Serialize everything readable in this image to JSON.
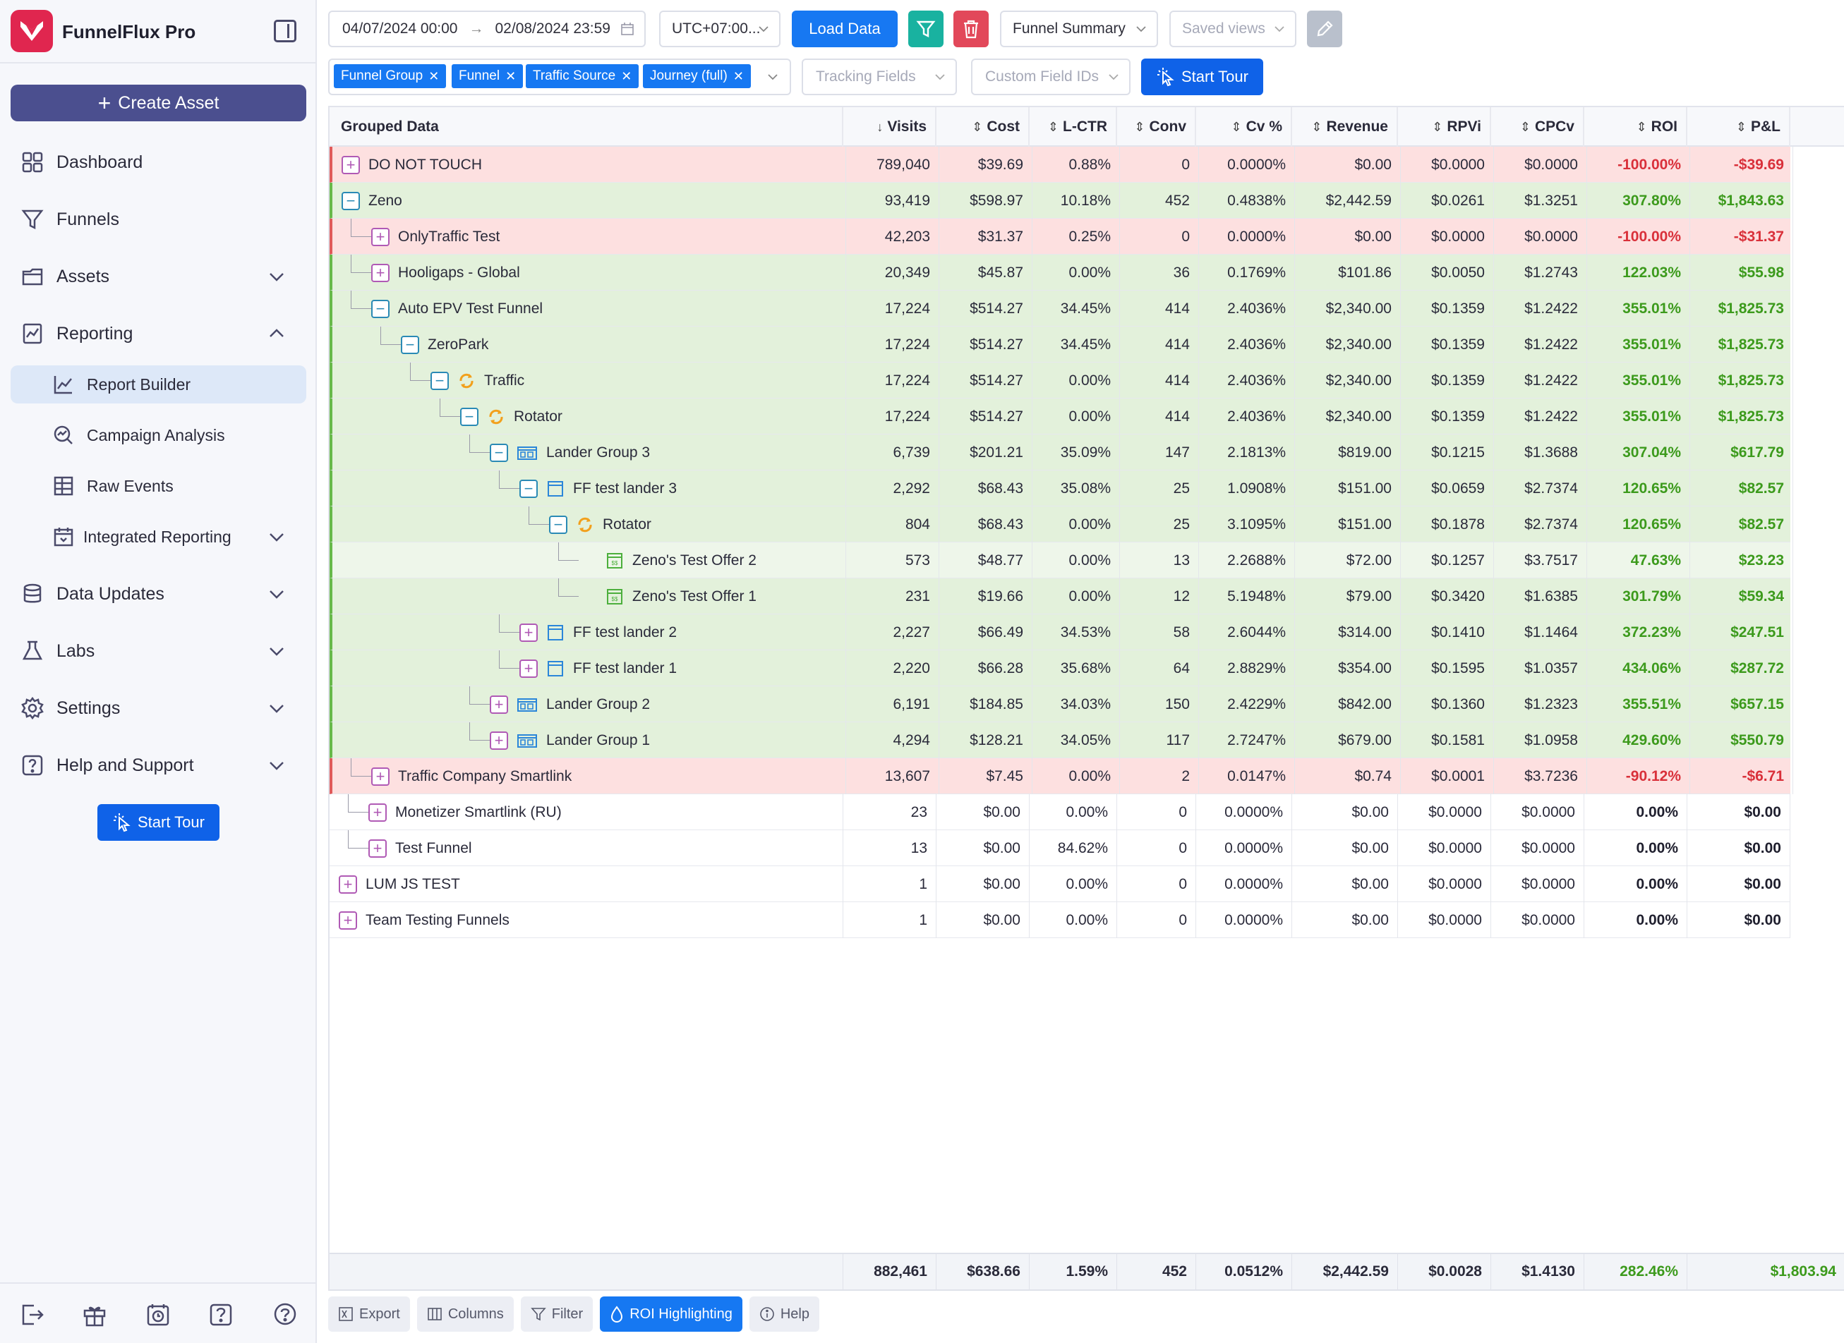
{
  "app": {
    "title": "FunnelFlux Pro"
  },
  "sidebar": {
    "create_label": "Create Asset",
    "items": [
      {
        "label": "Dashboard",
        "icon": "dashboard-icon"
      },
      {
        "label": "Funnels",
        "icon": "funnel-icon"
      },
      {
        "label": "Assets",
        "icon": "folder-icon"
      },
      {
        "label": "Reporting",
        "icon": "report-icon"
      },
      {
        "label": "Data Updates",
        "icon": "database-icon"
      },
      {
        "label": "Labs",
        "icon": "flask-icon"
      },
      {
        "label": "Settings",
        "icon": "gear-icon"
      },
      {
        "label": "Help and Support",
        "icon": "help-icon"
      }
    ],
    "sub_items": [
      {
        "label": "Report Builder",
        "icon": "chart-line-icon"
      },
      {
        "label": "Campaign Analysis",
        "icon": "magnify-chart-icon"
      },
      {
        "label": "Raw Events",
        "icon": "table-icon"
      },
      {
        "label": "Integrated Reporting",
        "icon": "calendar-grid-icon"
      }
    ],
    "start_tour": "Start Tour"
  },
  "toolbar": {
    "date_from": "04/07/2024 00:00",
    "date_to": "02/08/2024 23:59",
    "timezone": "UTC+07:00...",
    "load_data": "Load Data",
    "view_select": "Funnel Summary",
    "saved_views": "Saved views",
    "tracking_fields": "Tracking Fields",
    "custom_field_ids": "Custom Field IDs",
    "start_tour": "Start Tour",
    "chips": [
      "Funnel Group",
      "Funnel",
      "Traffic Source",
      "Journey (full)"
    ]
  },
  "table": {
    "headers": [
      "Grouped Data",
      "Visits",
      "Cost",
      "L-CTR",
      "Conv",
      "Cv %",
      "Revenue",
      "RPVi",
      "CPCv",
      "ROI",
      "P&L"
    ],
    "rows": [
      {
        "name": "DO NOT TOUCH",
        "visits": "789,040",
        "cost": "$39.69",
        "lctr": "0.88%",
        "conv": "0",
        "cv": "0.0000%",
        "revenue": "$0.00",
        "rpvi": "$0.0000",
        "cpcv": "$0.0000",
        "roi": "-100.00%",
        "pl": "-$39.69"
      },
      {
        "name": "Zeno",
        "visits": "93,419",
        "cost": "$598.97",
        "lctr": "10.18%",
        "conv": "452",
        "cv": "0.4838%",
        "revenue": "$2,442.59",
        "rpvi": "$0.0261",
        "cpcv": "$1.3251",
        "roi": "307.80%",
        "pl": "$1,843.63"
      },
      {
        "name": "OnlyTraffic Test",
        "visits": "42,203",
        "cost": "$31.37",
        "lctr": "0.25%",
        "conv": "0",
        "cv": "0.0000%",
        "revenue": "$0.00",
        "rpvi": "$0.0000",
        "cpcv": "$0.0000",
        "roi": "-100.00%",
        "pl": "-$31.37"
      },
      {
        "name": "Hooligaps - Global",
        "visits": "20,349",
        "cost": "$45.87",
        "lctr": "0.00%",
        "conv": "36",
        "cv": "0.1769%",
        "revenue": "$101.86",
        "rpvi": "$0.0050",
        "cpcv": "$1.2743",
        "roi": "122.03%",
        "pl": "$55.98"
      },
      {
        "name": "Auto EPV Test Funnel",
        "visits": "17,224",
        "cost": "$514.27",
        "lctr": "34.45%",
        "conv": "414",
        "cv": "2.4036%",
        "revenue": "$2,340.00",
        "rpvi": "$0.1359",
        "cpcv": "$1.2422",
        "roi": "355.01%",
        "pl": "$1,825.73"
      },
      {
        "name": "ZeroPark",
        "visits": "17,224",
        "cost": "$514.27",
        "lctr": "34.45%",
        "conv": "414",
        "cv": "2.4036%",
        "revenue": "$2,340.00",
        "rpvi": "$0.1359",
        "cpcv": "$1.2422",
        "roi": "355.01%",
        "pl": "$1,825.73"
      },
      {
        "name": "Traffic",
        "visits": "17,224",
        "cost": "$514.27",
        "lctr": "0.00%",
        "conv": "414",
        "cv": "2.4036%",
        "revenue": "$2,340.00",
        "rpvi": "$0.1359",
        "cpcv": "$1.2422",
        "roi": "355.01%",
        "pl": "$1,825.73"
      },
      {
        "name": "Rotator",
        "visits": "17,224",
        "cost": "$514.27",
        "lctr": "0.00%",
        "conv": "414",
        "cv": "2.4036%",
        "revenue": "$2,340.00",
        "rpvi": "$0.1359",
        "cpcv": "$1.2422",
        "roi": "355.01%",
        "pl": "$1,825.73"
      },
      {
        "name": "Lander Group 3",
        "visits": "6,739",
        "cost": "$201.21",
        "lctr": "35.09%",
        "conv": "147",
        "cv": "2.1813%",
        "revenue": "$819.00",
        "rpvi": "$0.1215",
        "cpcv": "$1.3688",
        "roi": "307.04%",
        "pl": "$617.79"
      },
      {
        "name": "FF test lander 3",
        "visits": "2,292",
        "cost": "$68.43",
        "lctr": "35.08%",
        "conv": "25",
        "cv": "1.0908%",
        "revenue": "$151.00",
        "rpvi": "$0.0659",
        "cpcv": "$2.7374",
        "roi": "120.65%",
        "pl": "$82.57"
      },
      {
        "name": "Rotator",
        "visits": "804",
        "cost": "$68.43",
        "lctr": "0.00%",
        "conv": "25",
        "cv": "3.1095%",
        "revenue": "$151.00",
        "rpvi": "$0.1878",
        "cpcv": "$2.7374",
        "roi": "120.65%",
        "pl": "$82.57"
      },
      {
        "name": "Zeno's Test Offer 2",
        "visits": "573",
        "cost": "$48.77",
        "lctr": "0.00%",
        "conv": "13",
        "cv": "2.2688%",
        "revenue": "$72.00",
        "rpvi": "$0.1257",
        "cpcv": "$3.7517",
        "roi": "47.63%",
        "pl": "$23.23"
      },
      {
        "name": "Zeno's Test Offer 1",
        "visits": "231",
        "cost": "$19.66",
        "lctr": "0.00%",
        "conv": "12",
        "cv": "5.1948%",
        "revenue": "$79.00",
        "rpvi": "$0.3420",
        "cpcv": "$1.6385",
        "roi": "301.79%",
        "pl": "$59.34"
      },
      {
        "name": "FF test lander 2",
        "visits": "2,227",
        "cost": "$66.49",
        "lctr": "34.53%",
        "conv": "58",
        "cv": "2.6044%",
        "revenue": "$314.00",
        "rpvi": "$0.1410",
        "cpcv": "$1.1464",
        "roi": "372.23%",
        "pl": "$247.51"
      },
      {
        "name": "FF test lander 1",
        "visits": "2,220",
        "cost": "$66.28",
        "lctr": "35.68%",
        "conv": "64",
        "cv": "2.8829%",
        "revenue": "$354.00",
        "rpvi": "$0.1595",
        "cpcv": "$1.0357",
        "roi": "434.06%",
        "pl": "$287.72"
      },
      {
        "name": "Lander Group 2",
        "visits": "6,191",
        "cost": "$184.85",
        "lctr": "34.03%",
        "conv": "150",
        "cv": "2.4229%",
        "revenue": "$842.00",
        "rpvi": "$0.1360",
        "cpcv": "$1.2323",
        "roi": "355.51%",
        "pl": "$657.15"
      },
      {
        "name": "Lander Group 1",
        "visits": "4,294",
        "cost": "$128.21",
        "lctr": "34.05%",
        "conv": "117",
        "cv": "2.7247%",
        "revenue": "$679.00",
        "rpvi": "$0.1581",
        "cpcv": "$1.0958",
        "roi": "429.60%",
        "pl": "$550.79"
      },
      {
        "name": "Traffic Company Smartlink",
        "visits": "13,607",
        "cost": "$7.45",
        "lctr": "0.00%",
        "conv": "2",
        "cv": "0.0147%",
        "revenue": "$0.74",
        "rpvi": "$0.0001",
        "cpcv": "$3.7236",
        "roi": "-90.12%",
        "pl": "-$6.71"
      },
      {
        "name": "Monetizer Smartlink (RU)",
        "visits": "23",
        "cost": "$0.00",
        "lctr": "0.00%",
        "conv": "0",
        "cv": "0.0000%",
        "revenue": "$0.00",
        "rpvi": "$0.0000",
        "cpcv": "$0.0000",
        "roi": "0.00%",
        "pl": "$0.00"
      },
      {
        "name": "Test Funnel",
        "visits": "13",
        "cost": "$0.00",
        "lctr": "84.62%",
        "conv": "0",
        "cv": "0.0000%",
        "revenue": "$0.00",
        "rpvi": "$0.0000",
        "cpcv": "$0.0000",
        "roi": "0.00%",
        "pl": "$0.00"
      },
      {
        "name": "LUM JS TEST",
        "visits": "1",
        "cost": "$0.00",
        "lctr": "0.00%",
        "conv": "0",
        "cv": "0.0000%",
        "revenue": "$0.00",
        "rpvi": "$0.0000",
        "cpcv": "$0.0000",
        "roi": "0.00%",
        "pl": "$0.00"
      },
      {
        "name": "Team Testing Funnels",
        "visits": "1",
        "cost": "$0.00",
        "lctr": "0.00%",
        "conv": "0",
        "cv": "0.0000%",
        "revenue": "$0.00",
        "rpvi": "$0.0000",
        "cpcv": "$0.0000",
        "roi": "0.00%",
        "pl": "$0.00"
      }
    ],
    "totals": {
      "visits": "882,461",
      "cost": "$638.66",
      "lctr": "1.59%",
      "conv": "452",
      "cv": "0.0512%",
      "revenue": "$2,442.59",
      "rpvi": "$0.0028",
      "cpcv": "$1.4130",
      "roi": "282.46%",
      "pl": "$1,803.94"
    }
  },
  "bottom_bar": {
    "export": "Export",
    "columns": "Columns",
    "filter": "Filter",
    "roi_highlighting": "ROI Highlighting",
    "help": "Help"
  },
  "colors": {
    "brand": "#e0264f",
    "primary": "#1778f2",
    "create": "#4b4f8f",
    "positive": "#3c9a1c",
    "negative": "#d9303a",
    "red_row": "#fde0e0",
    "green_row": "#e3f1db"
  }
}
